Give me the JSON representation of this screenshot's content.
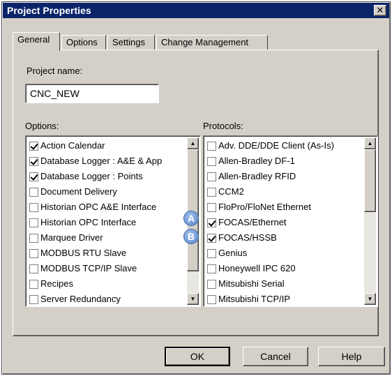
{
  "window": {
    "title": "Project Properties",
    "close_glyph": "✕"
  },
  "tabs": [
    {
      "label": "General"
    },
    {
      "label": "Options"
    },
    {
      "label": "Settings"
    },
    {
      "label": "Change Management"
    }
  ],
  "project_name": {
    "label": "Project name:",
    "value": "CNC_NEW"
  },
  "options": {
    "label": "Options:",
    "items": [
      {
        "label": "Action Calendar",
        "checked": true
      },
      {
        "label": "Database Logger : A&E & App",
        "checked": true
      },
      {
        "label": "Database Logger : Points",
        "checked": true
      },
      {
        "label": "Document Delivery",
        "checked": false
      },
      {
        "label": "Historian OPC A&E Interface",
        "checked": false
      },
      {
        "label": "Historian OPC Interface",
        "checked": false
      },
      {
        "label": "Marquee Driver",
        "checked": false
      },
      {
        "label": "MODBUS RTU Slave",
        "checked": false
      },
      {
        "label": "MODBUS TCP/IP Slave",
        "checked": false
      },
      {
        "label": "Recipes",
        "checked": false
      },
      {
        "label": "Server Redundancy",
        "checked": false
      }
    ]
  },
  "protocols": {
    "label": "Protocols:",
    "items": [
      {
        "label": "Adv. DDE/DDE Client (As-Is)",
        "checked": false
      },
      {
        "label": "Allen-Bradley DF-1",
        "checked": false
      },
      {
        "label": "Allen-Bradley RFID",
        "checked": false
      },
      {
        "label": "CCM2",
        "checked": false
      },
      {
        "label": "FloPro/FloNet Ethernet",
        "checked": false
      },
      {
        "label": "FOCAS/Ethernet",
        "checked": true
      },
      {
        "label": "FOCAS/HSSB",
        "checked": true
      },
      {
        "label": "Genius",
        "checked": false
      },
      {
        "label": "Honeywell IPC 620",
        "checked": false
      },
      {
        "label": "Mitsubishi Serial",
        "checked": false
      },
      {
        "label": "Mitsubishi TCP/IP",
        "checked": false
      }
    ]
  },
  "markers": {
    "a": "A",
    "b": "B"
  },
  "buttons": {
    "ok": "OK",
    "cancel": "Cancel",
    "help": "Help"
  },
  "icons": {
    "scroll_up": "▲",
    "scroll_down": "▼"
  }
}
